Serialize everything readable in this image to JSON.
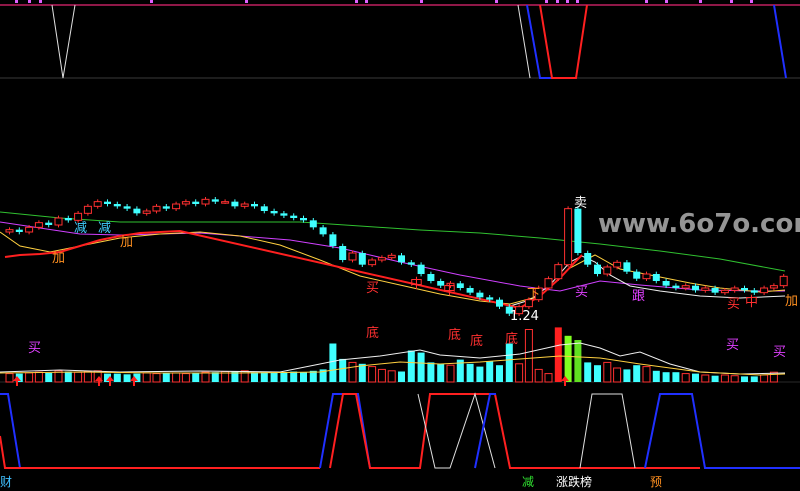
{
  "watermark": "www.6o7o.com",
  "colors": {
    "bg": "#000000",
    "up": "#ff3030",
    "down": "#40ffff",
    "ma_yellow": "#ffd040",
    "ma_magenta": "#d040ff",
    "ma_green": "#30c030",
    "ma_white": "#f0f0f0",
    "signal_red": "#ff2020",
    "signal_blue": "#2030ff",
    "label_magenta": "#e040ff",
    "label_red": "#ff3030",
    "label_orange": "#ff9020"
  },
  "price_annotation": "1.24",
  "chart_labels": {
    "sell": "卖",
    "buy": "买",
    "bottom": "底",
    "add": "加",
    "reduce": "减",
    "mid": "中",
    "down": "下",
    "follow": "跟"
  },
  "bottom_bar": {
    "left": "财",
    "reduce": "减",
    "limit_list": "涨跌榜",
    "predict": "预"
  },
  "chart_data": {
    "type": "candlestick",
    "title": "",
    "min_price": 1.24,
    "candles": [
      {
        "o": 1.62,
        "c": 1.63
      },
      {
        "o": 1.63,
        "c": 1.62
      },
      {
        "o": 1.62,
        "c": 1.64
      },
      {
        "o": 1.64,
        "c": 1.66
      },
      {
        "o": 1.66,
        "c": 1.65
      },
      {
        "o": 1.65,
        "c": 1.68
      },
      {
        "o": 1.68,
        "c": 1.67
      },
      {
        "o": 1.67,
        "c": 1.7
      },
      {
        "o": 1.7,
        "c": 1.73
      },
      {
        "o": 1.73,
        "c": 1.75
      },
      {
        "o": 1.75,
        "c": 1.74
      },
      {
        "o": 1.74,
        "c": 1.73
      },
      {
        "o": 1.73,
        "c": 1.72
      },
      {
        "o": 1.72,
        "c": 1.7
      },
      {
        "o": 1.7,
        "c": 1.71
      },
      {
        "o": 1.71,
        "c": 1.73
      },
      {
        "o": 1.73,
        "c": 1.72
      },
      {
        "o": 1.72,
        "c": 1.74
      },
      {
        "o": 1.74,
        "c": 1.75
      },
      {
        "o": 1.75,
        "c": 1.74
      },
      {
        "o": 1.74,
        "c": 1.76
      },
      {
        "o": 1.76,
        "c": 1.75
      },
      {
        "o": 1.75,
        "c": 1.75
      },
      {
        "o": 1.75,
        "c": 1.73
      },
      {
        "o": 1.73,
        "c": 1.74
      },
      {
        "o": 1.74,
        "c": 1.73
      },
      {
        "o": 1.73,
        "c": 1.71
      },
      {
        "o": 1.71,
        "c": 1.7
      },
      {
        "o": 1.7,
        "c": 1.69
      },
      {
        "o": 1.69,
        "c": 1.68
      },
      {
        "o": 1.68,
        "c": 1.67
      },
      {
        "o": 1.67,
        "c": 1.64
      },
      {
        "o": 1.64,
        "c": 1.61
      },
      {
        "o": 1.61,
        "c": 1.56
      },
      {
        "o": 1.56,
        "c": 1.5
      },
      {
        "o": 1.5,
        "c": 1.53
      },
      {
        "o": 1.53,
        "c": 1.48
      },
      {
        "o": 1.48,
        "c": 1.5
      },
      {
        "o": 1.5,
        "c": 1.51
      },
      {
        "o": 1.51,
        "c": 1.52
      },
      {
        "o": 1.52,
        "c": 1.49
      },
      {
        "o": 1.49,
        "c": 1.48
      },
      {
        "o": 1.48,
        "c": 1.44
      },
      {
        "o": 1.44,
        "c": 1.41
      },
      {
        "o": 1.41,
        "c": 1.39
      },
      {
        "o": 1.39,
        "c": 1.4
      },
      {
        "o": 1.4,
        "c": 1.38
      },
      {
        "o": 1.38,
        "c": 1.36
      },
      {
        "o": 1.36,
        "c": 1.34
      },
      {
        "o": 1.34,
        "c": 1.33
      },
      {
        "o": 1.33,
        "c": 1.3
      },
      {
        "o": 1.3,
        "c": 1.27
      },
      {
        "o": 1.27,
        "c": 1.3
      },
      {
        "o": 1.3,
        "c": 1.33
      },
      {
        "o": 1.33,
        "c": 1.38
      },
      {
        "o": 1.38,
        "c": 1.42
      },
      {
        "o": 1.42,
        "c": 1.48
      },
      {
        "o": 1.48,
        "c": 1.72
      },
      {
        "o": 1.72,
        "c": 1.53
      },
      {
        "o": 1.53,
        "c": 1.48
      },
      {
        "o": 1.48,
        "c": 1.44
      },
      {
        "o": 1.44,
        "c": 1.47
      },
      {
        "o": 1.47,
        "c": 1.49
      },
      {
        "o": 1.49,
        "c": 1.45
      },
      {
        "o": 1.45,
        "c": 1.42
      },
      {
        "o": 1.42,
        "c": 1.44
      },
      {
        "o": 1.44,
        "c": 1.41
      },
      {
        "o": 1.41,
        "c": 1.39
      },
      {
        "o": 1.39,
        "c": 1.38
      },
      {
        "o": 1.38,
        "c": 1.39
      },
      {
        "o": 1.39,
        "c": 1.37
      },
      {
        "o": 1.37,
        "c": 1.38
      },
      {
        "o": 1.38,
        "c": 1.36
      },
      {
        "o": 1.36,
        "c": 1.37
      },
      {
        "o": 1.37,
        "c": 1.38
      },
      {
        "o": 1.38,
        "c": 1.37
      },
      {
        "o": 1.37,
        "c": 1.36
      },
      {
        "o": 1.36,
        "c": 1.38
      },
      {
        "o": 1.38,
        "c": 1.39
      },
      {
        "o": 1.39,
        "c": 1.43
      }
    ],
    "volumes": [
      0.12,
      0.12,
      0.13,
      0.14,
      0.13,
      0.16,
      0.15,
      0.14,
      0.15,
      0.16,
      0.12,
      0.12,
      0.11,
      0.12,
      0.13,
      0.12,
      0.13,
      0.13,
      0.12,
      0.13,
      0.14,
      0.14,
      0.15,
      0.15,
      0.16,
      0.14,
      0.14,
      0.13,
      0.14,
      0.15,
      0.14,
      0.16,
      0.18,
      0.55,
      0.33,
      0.28,
      0.26,
      0.22,
      0.18,
      0.16,
      0.15,
      0.45,
      0.42,
      0.28,
      0.26,
      0.24,
      0.32,
      0.26,
      0.22,
      0.3,
      0.24,
      0.55,
      0.26,
      0.75,
      0.18,
      0.12,
      0.78,
      0.66,
      0.6,
      0.28,
      0.24,
      0.28,
      0.2,
      0.18,
      0.24,
      0.22,
      0.16,
      0.14,
      0.14,
      0.12,
      0.12,
      0.1,
      0.09,
      0.1,
      0.09,
      0.08,
      0.08,
      0.1,
      0.14
    ]
  }
}
